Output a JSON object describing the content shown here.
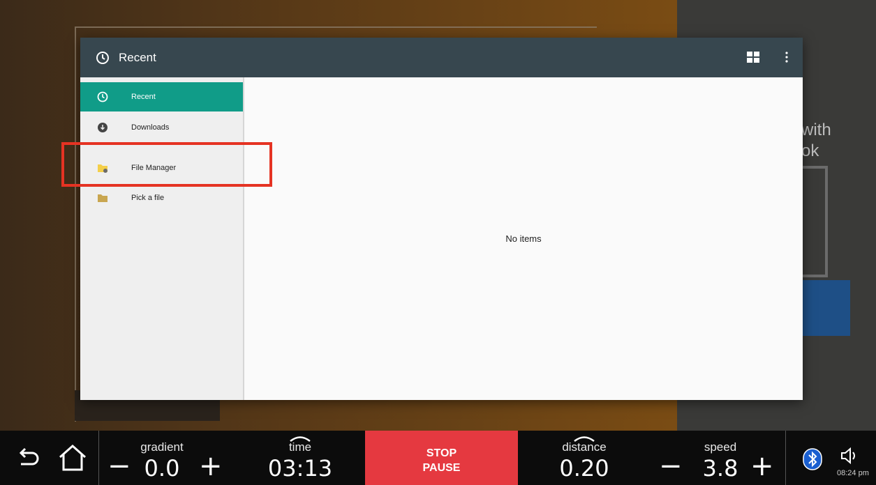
{
  "dialog": {
    "title": "Recent",
    "drawer": {
      "items": [
        {
          "label": "Recent",
          "icon": "clock-icon",
          "active": true
        },
        {
          "label": "Downloads",
          "icon": "download-icon",
          "active": false
        },
        {
          "label": "File Manager",
          "icon": "folder-manager-icon",
          "active": false
        },
        {
          "label": "Pick a file",
          "icon": "folder-icon",
          "active": false
        }
      ]
    },
    "content": {
      "empty_message": "No items"
    }
  },
  "background": {
    "partial_text_line1": "with",
    "partial_text_line2": "ok"
  },
  "workout_bar": {
    "gradient": {
      "label": "gradient",
      "value": "0.0"
    },
    "time": {
      "label": "time",
      "value": "03:13"
    },
    "stop_pause": {
      "line1": "STOP",
      "line2": "PAUSE"
    },
    "distance": {
      "label": "distance",
      "value": "0.20"
    },
    "speed": {
      "label": "speed",
      "value": "3.8"
    },
    "minus": "−",
    "plus": "+",
    "clock": "08:24 pm"
  },
  "colors": {
    "appbar": "#37474f",
    "active_nav": "#109c88",
    "stop_button": "#e53940",
    "highlight": "#e53323"
  }
}
